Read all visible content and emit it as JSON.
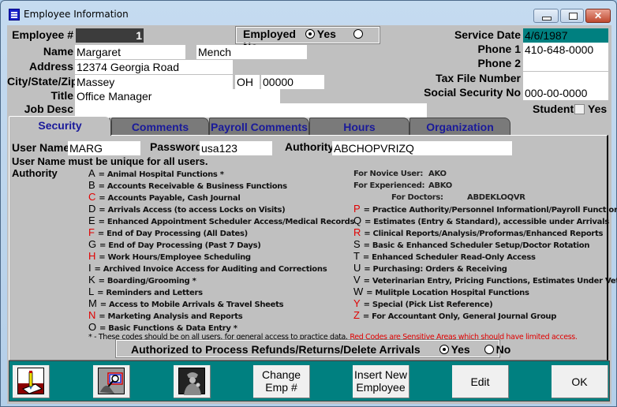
{
  "window": {
    "title": "Employee Information"
  },
  "header": {
    "employee_num_label": "Employee #",
    "employee_num": "1",
    "employed_label": "Employed",
    "employed_options": [
      "Yes",
      "No"
    ],
    "employed_selected": "Yes",
    "name_label": "Name",
    "first_name": "Margaret",
    "last_name": "Mench",
    "address_label": "Address",
    "address": "12374 Georgia Road",
    "city_label": "City/State/Zip",
    "city": "Massey",
    "state": "OH",
    "zip": "00000",
    "title_label": "Title",
    "title": "Office Manager",
    "job_desc_label": "Job Desc",
    "job_desc": "",
    "service_date_label": "Service Date",
    "service_date": "4/6/1987",
    "phone1_label": "Phone 1",
    "phone1": "410-648-0000",
    "phone2_label": "Phone 2",
    "phone2": "",
    "tax_file_label": "Tax File Number",
    "tax_file": "",
    "ssn_label": "Social Security No",
    "ssn": "000-00-0000",
    "student_label": "Student",
    "student_yes_label": "Yes",
    "student_checked": false
  },
  "tabs": [
    {
      "label": "Security",
      "active": true
    },
    {
      "label": "Comments",
      "active": false
    },
    {
      "label": "Payroll Comments",
      "active": false
    },
    {
      "label": "Hours",
      "active": false
    },
    {
      "label": "Organization",
      "active": false
    }
  ],
  "security": {
    "username_label": "User Name",
    "username": "MARG",
    "password_label": "Password",
    "password": "usa123",
    "authority_label": "Authority",
    "authority": "ABCHOPVRIZQ",
    "unique_note": "User Name must be unique for all users.",
    "authority_heading": "Authority",
    "presets": {
      "novice_label": "For Novice User:",
      "novice": "AKO",
      "experienced_label": "For Experienced:",
      "experienced": "ABKO",
      "doctors_label": "For Doctors:",
      "doctors": "ABDEKLOQVR"
    },
    "codes_left": [
      {
        "code": "A",
        "red": false,
        "desc": "= Animal Hospital Functions *"
      },
      {
        "code": "B",
        "red": false,
        "desc": "= Accounts Receivable & Business Functions"
      },
      {
        "code": "C",
        "red": true,
        "desc": "= Accounts Payable, Cash Journal"
      },
      {
        "code": "D",
        "red": false,
        "desc": "= Arrivals Access (to access Locks on Visits)"
      },
      {
        "code": "E",
        "red": false,
        "desc": "= Enhanced Appointment Scheduler Access/Medical Records"
      },
      {
        "code": "F",
        "red": true,
        "desc": "= End of Day Processing (All Dates)"
      },
      {
        "code": "G",
        "red": false,
        "desc": "= End of Day Processing (Past 7 Days)"
      },
      {
        "code": "H",
        "red": true,
        "desc": "= Work Hours/Employee Scheduling"
      },
      {
        "code": "I",
        "red": false,
        "desc": "= Archived Invoice Access for Auditing and Corrections"
      },
      {
        "code": "K",
        "red": false,
        "desc": "= Boarding/Grooming *"
      },
      {
        "code": "L",
        "red": false,
        "desc": "= Reminders and Letters"
      },
      {
        "code": "M",
        "red": false,
        "desc": "= Access to Mobile Arrivals & Travel Sheets"
      },
      {
        "code": "N",
        "red": true,
        "desc": "= Marketing Analysis and Reports"
      },
      {
        "code": "O",
        "red": false,
        "desc": "= Basic Functions & Data Entry *"
      }
    ],
    "codes_right": [
      {
        "code": "P",
        "red": true,
        "desc": "= Practice Authority/Personnel Informationl/Payroll Functions"
      },
      {
        "code": "Q",
        "red": false,
        "desc": "= Estimates (Entry & Standard), accessible under Arrivals"
      },
      {
        "code": "R",
        "red": true,
        "desc": "= Clinical Reports/Analysis/Proformas/Enhanced Reports"
      },
      {
        "code": "S",
        "red": false,
        "desc": "= Basic & Enhanced Scheduler Setup/Doctor Rotation"
      },
      {
        "code": "T",
        "red": false,
        "desc": "= Enhanced Scheduler Read-Only Access"
      },
      {
        "code": "U",
        "red": false,
        "desc": "= Purchasing: Orders & Receiving"
      },
      {
        "code": "V",
        "red": false,
        "desc": "= Veterinarian Entry, Pricing Functions, Estimates Under Vet Entry"
      },
      {
        "code": "W",
        "red": false,
        "desc": "= Mulitple Location Hospital Functions"
      },
      {
        "code": "Y",
        "red": true,
        "desc": "= Special (Pick List Reference)"
      },
      {
        "code": "Z",
        "red": true,
        "desc": "= For Accountant Only, General Journal Group"
      }
    ],
    "footnote_black": "* - These codes should be on all users, for general access to practice data.",
    "footnote_red": "Red Codes are Sensitive Areas which should have limited access.",
    "refund_label": "Authorized to Process Refunds/Returns/Delete Arrivals",
    "refund_options": [
      "Yes",
      "No"
    ],
    "refund_selected": "Yes"
  },
  "toolbar": {
    "buttons": [
      {
        "icon": "pencil-notepad-icon"
      },
      {
        "icon": "magnifier-search-icon"
      },
      {
        "icon": "detective-icon"
      },
      {
        "label_line1": "Change",
        "label_line2": "Emp #"
      },
      {
        "label_line1": "Insert New",
        "label_line2": "Employee"
      },
      {
        "label": "Edit"
      },
      {
        "label": "OK"
      }
    ]
  },
  "colors": {
    "teal": "#008080",
    "form_gray": "#c0c0c0",
    "sensitive_red": "#e00000",
    "tab_text_blue": "#1a1a9a"
  }
}
